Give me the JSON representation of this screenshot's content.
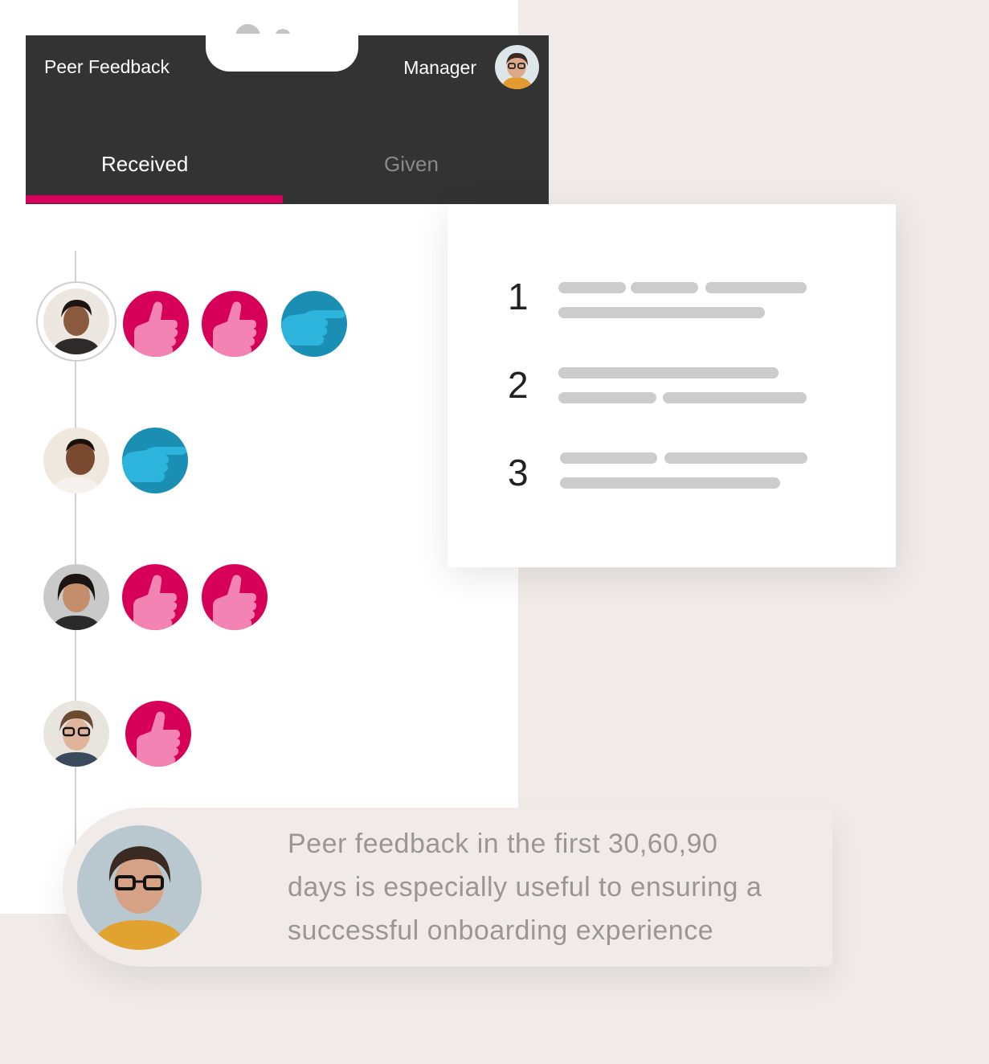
{
  "header": {
    "title": "Peer Feedback",
    "role_label": "Manager"
  },
  "tabs": [
    {
      "label": "Received",
      "active": true
    },
    {
      "label": "Given",
      "active": false
    }
  ],
  "colors": {
    "header_bg": "#333333",
    "accent": "#d9005b",
    "kudos_badge": "#d60059",
    "direction_badge": "#1a8fb3",
    "page_bg": "#f0ebe8"
  },
  "feedback_rows": [
    {
      "badges": [
        "thumbs-up-icon",
        "thumbs-up-icon",
        "pointing-hand-icon"
      ],
      "selected": true
    },
    {
      "badges": [
        "pointing-hand-icon"
      ],
      "selected": false
    },
    {
      "badges": [
        "thumbs-up-icon",
        "thumbs-up-icon"
      ],
      "selected": false
    },
    {
      "badges": [
        "thumbs-up-icon"
      ],
      "selected": false
    }
  ],
  "popover": {
    "items": [
      {
        "number": "1"
      },
      {
        "number": "2"
      },
      {
        "number": "3"
      }
    ]
  },
  "quote": {
    "text_line1": "Peer feedback in the first 30,60,90",
    "text_line2": "days is especially useful to ensuring a",
    "text_line3": "successful onboarding experience"
  }
}
